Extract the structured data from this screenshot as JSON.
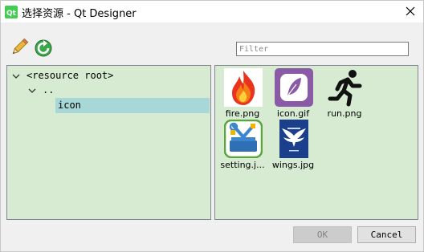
{
  "window": {
    "title": "选择资源 - Qt Designer"
  },
  "toolbar": {
    "edit_icon": "pencil-icon",
    "reload_icon": "reload-icon",
    "filter_placeholder": "Filter"
  },
  "tree": {
    "items": [
      {
        "label": "<resource root>",
        "expanded": true,
        "selected": false
      },
      {
        "label": "..",
        "expanded": true,
        "selected": false
      },
      {
        "label": "icon",
        "selected": true
      }
    ]
  },
  "files": {
    "items": [
      {
        "label": "fire.png",
        "icon": "flame-icon"
      },
      {
        "label": "icon.gif",
        "icon": "feather-icon"
      },
      {
        "label": "run.png",
        "icon": "runner-icon"
      },
      {
        "label": "setting.j...",
        "icon": "tools-icon"
      },
      {
        "label": "wings.jpg",
        "icon": "wings-logo-icon"
      }
    ]
  },
  "buttons": {
    "ok": "OK",
    "cancel": "Cancel"
  },
  "colors": {
    "panel_background": "#d6ebd2",
    "selection": "#a8d7d7",
    "accent_green": "#2e9a3a"
  }
}
